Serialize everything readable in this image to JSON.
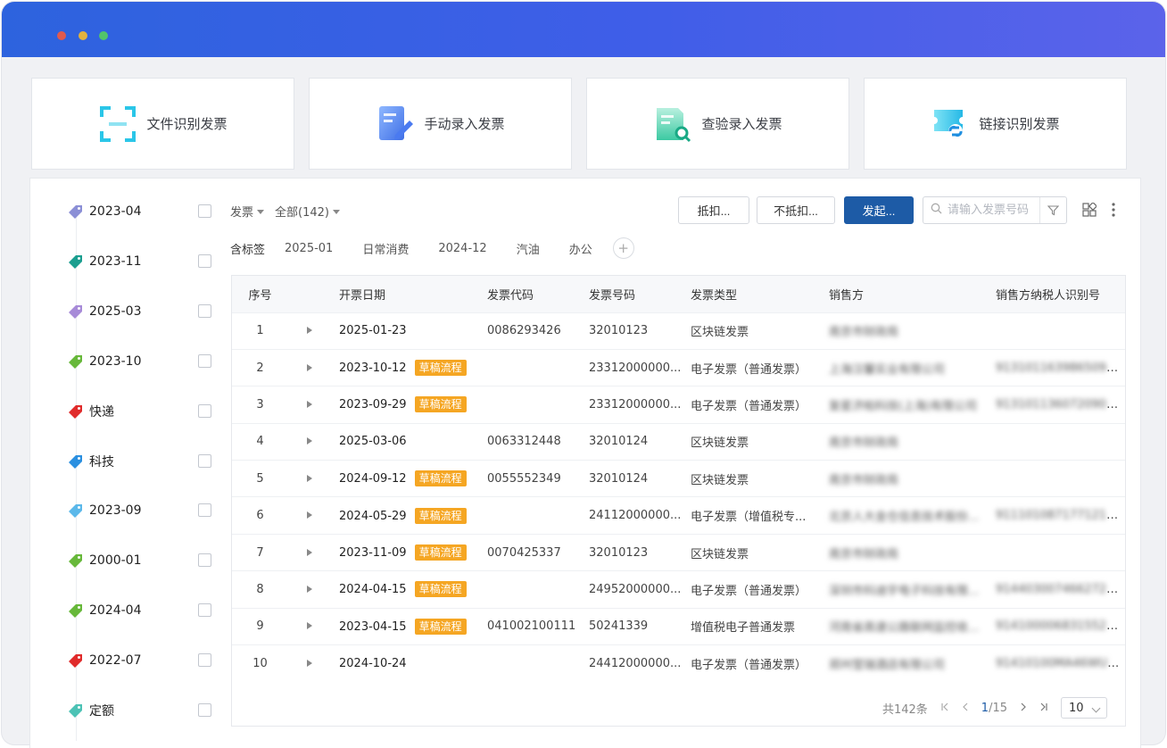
{
  "cards": [
    {
      "label": "文件识别发票",
      "icon": "scan-icon"
    },
    {
      "label": "手动录入发票",
      "icon": "edit-doc-icon"
    },
    {
      "label": "查验录入发票",
      "icon": "search-doc-icon"
    },
    {
      "label": "链接识别发票",
      "icon": "link-ticket-icon"
    }
  ],
  "sidebar": {
    "tags": [
      {
        "name": "2023-04",
        "color": "#8b8fd6"
      },
      {
        "name": "2023-11",
        "color": "#1b9e8f"
      },
      {
        "name": "2025-03",
        "color": "#a78bd8"
      },
      {
        "name": "2023-10",
        "color": "#67b83a"
      },
      {
        "name": "快递",
        "color": "#e02b2b"
      },
      {
        "name": "科技",
        "color": "#2a8fe0"
      },
      {
        "name": "2023-09",
        "color": "#5bb8ea"
      },
      {
        "name": "2000-01",
        "color": "#67b83a"
      },
      {
        "name": "2024-04",
        "color": "#67b83a"
      },
      {
        "name": "2022-07",
        "color": "#e02b2b"
      },
      {
        "name": "定额",
        "color": "#4cc2b5"
      }
    ]
  },
  "toolbar": {
    "type_filter": "发票",
    "scope_filter": "全部(142)",
    "btn_deduct": "抵扣...",
    "btn_no_deduct": "不抵扣...",
    "btn_initiate": "发起...",
    "search_placeholder": "请输入发票号码"
  },
  "labels": {
    "title": "含标签",
    "items": [
      "2025-01",
      "日常消费",
      "2024-12",
      "汽油",
      "办公"
    ]
  },
  "table": {
    "headers": [
      "序号",
      "",
      "开票日期",
      "发票代码",
      "发票号码",
      "发票类型",
      "销售方",
      "销售方纳税人识别号"
    ],
    "draft_label": "草稿流程",
    "rows": [
      {
        "no": "1",
        "date": "2025-01-23",
        "draft": false,
        "code": "0086293426",
        "number": "32010123",
        "type": "区块链发票",
        "seller": "南京市财政局",
        "taxid": ""
      },
      {
        "no": "2",
        "date": "2023-10-12",
        "draft": true,
        "code": "",
        "number": "23312000000...",
        "type": "电子发票（普通发票）",
        "seller": "上海汉馨实业有限公司",
        "taxid": "91310116398650950U"
      },
      {
        "no": "3",
        "date": "2023-09-29",
        "draft": true,
        "code": "",
        "number": "23312000000...",
        "type": "电子发票（普通发票）",
        "seller": "复星济帕科技(上海)有限公司",
        "taxid": "91310113607209011M"
      },
      {
        "no": "4",
        "date": "2025-03-06",
        "draft": false,
        "code": "0063312448",
        "number": "32010124",
        "type": "区块链发票",
        "seller": "南京市财政局",
        "taxid": ""
      },
      {
        "no": "5",
        "date": "2024-09-12",
        "draft": true,
        "code": "0055552349",
        "number": "32010124",
        "type": "区块链发票",
        "seller": "南京市财政局",
        "taxid": ""
      },
      {
        "no": "6",
        "date": "2024-05-29",
        "draft": true,
        "code": "",
        "number": "24112000000...",
        "type": "电子发票（增值税专...",
        "seller": "北京人大金仓信息技术股份...",
        "taxid": "91110108717712101S"
      },
      {
        "no": "7",
        "date": "2023-11-09",
        "draft": true,
        "code": "0070425337",
        "number": "32010123",
        "type": "区块链发票",
        "seller": "南京市财政局",
        "taxid": ""
      },
      {
        "no": "8",
        "date": "2024-04-15",
        "draft": true,
        "code": "",
        "number": "24952000000...",
        "type": "电子发票（普通发票）",
        "seller": "深圳市科迪宇电子科技有限...",
        "taxid": "914403007466272Z2M"
      },
      {
        "no": "9",
        "date": "2023-04-15",
        "draft": true,
        "code": "041002100111",
        "number": "50241339",
        "type": "增值税电子普通发票",
        "seller": "河南省高速公路联网监控收...",
        "taxid": "91410000683155223XR"
      },
      {
        "no": "10",
        "date": "2024-10-24",
        "draft": false,
        "code": "",
        "number": "24412000000...",
        "type": "电子发票（普通发票）",
        "seller": "郑州莹瑞酒店有限公司",
        "taxid": "91410100MA46WU719K"
      }
    ]
  },
  "pager": {
    "total": "共142条",
    "current": "1",
    "pages": "/15",
    "page_size": "10"
  }
}
